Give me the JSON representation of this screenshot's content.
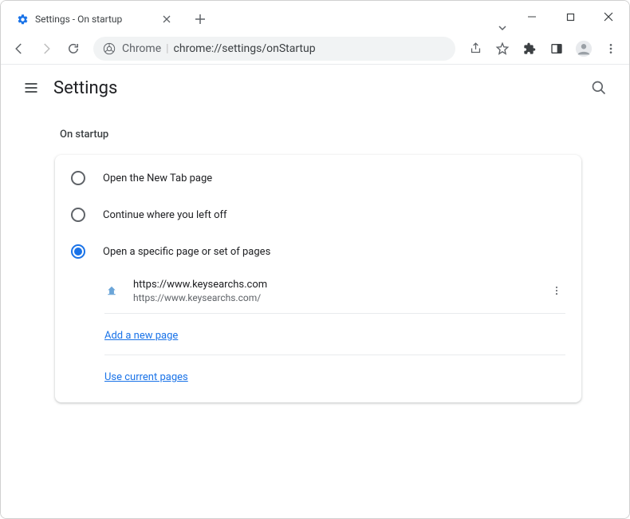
{
  "window": {
    "tab_title": "Settings - On startup"
  },
  "omnibox": {
    "chip": "Chrome",
    "url": "chrome://settings/onStartup"
  },
  "header": {
    "title": "Settings"
  },
  "section": {
    "title": "On startup"
  },
  "options": {
    "new_tab": "Open the New Tab page",
    "continue": "Continue where you left off",
    "specific": "Open a specific page or set of pages"
  },
  "startup_page": {
    "title": "https://www.keysearchs.com",
    "url": "https://www.keysearchs.com/"
  },
  "links": {
    "add": "Add a new page",
    "current": "Use current pages"
  }
}
